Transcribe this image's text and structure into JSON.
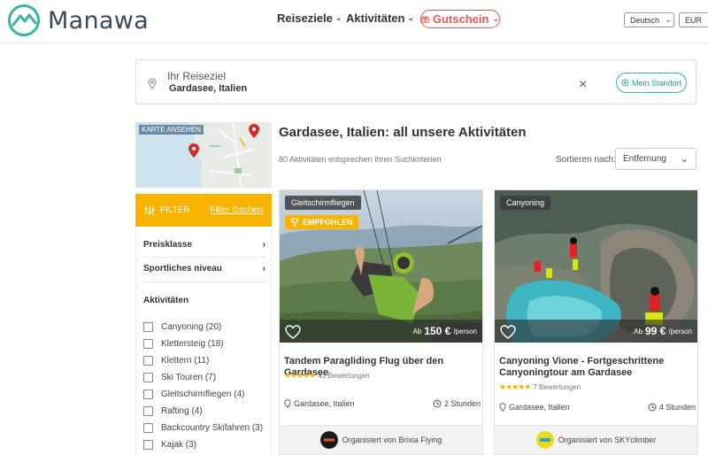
{
  "header": {
    "brand": "Manawa",
    "nav": [
      {
        "label": "Reiseziele"
      },
      {
        "label": "Aktivitäten"
      }
    ],
    "gutschein": "Gutschein",
    "language": "Deutsch",
    "currency": "EUR"
  },
  "search": {
    "label": "Ihr Reiseziel",
    "value": "Gardasee, Italien",
    "location_button": "Mein Standort"
  },
  "map": {
    "label": "KARTE ANSEHEN"
  },
  "filter": {
    "label": "FILTER",
    "clear": "Filter löschen"
  },
  "facets": {
    "price": "Preisklasse",
    "level": "Sportliches niveau",
    "activities_title": "Aktivitäten",
    "activities": [
      "Canyoning (20)",
      "Klettersteig (18)",
      "Klettern (11)",
      "Ski Touren (7)",
      "Gleitschirmfliegen (4)",
      "Rafting (4)",
      "Backcountry Skifahren (3)",
      "Kajak (3)"
    ]
  },
  "main": {
    "title": "Gardasee, Italien: all unsere Aktivitäten",
    "results": "80 Aktivitäten entsprechen Ihren Suchkriterien",
    "sort_label": "Sortieren nach:",
    "sort_value": "Entfernung"
  },
  "cards": [
    {
      "category": "Gleitschirmfliegen",
      "badge": "EMPFOHLEN",
      "price_prefix": "Ab",
      "price": "150 €",
      "price_unit": "/person",
      "title": "Tandem Paragliding Flug über den Gardasee",
      "reviews": "41 Bewertungen",
      "location": "Gardasee, Italien",
      "duration": "2 Stunden",
      "organizer": "Organisiert von Brixia Flying"
    },
    {
      "category": "Canyoning",
      "price_prefix": "Ab",
      "price": "99 €",
      "price_unit": "/person",
      "title": "Canyoning Vione - Fortgeschrittene Canyoningtour am Gardasee",
      "reviews": "7 Bewertungen",
      "location": "Gardasee, Italien",
      "duration": "4 Stunden",
      "organizer": "Organisiert von SKYclimber"
    }
  ],
  "colors": {
    "accent": "#f6b300",
    "brand": "#3ab5a5",
    "gutschein": "#ea5a53"
  }
}
